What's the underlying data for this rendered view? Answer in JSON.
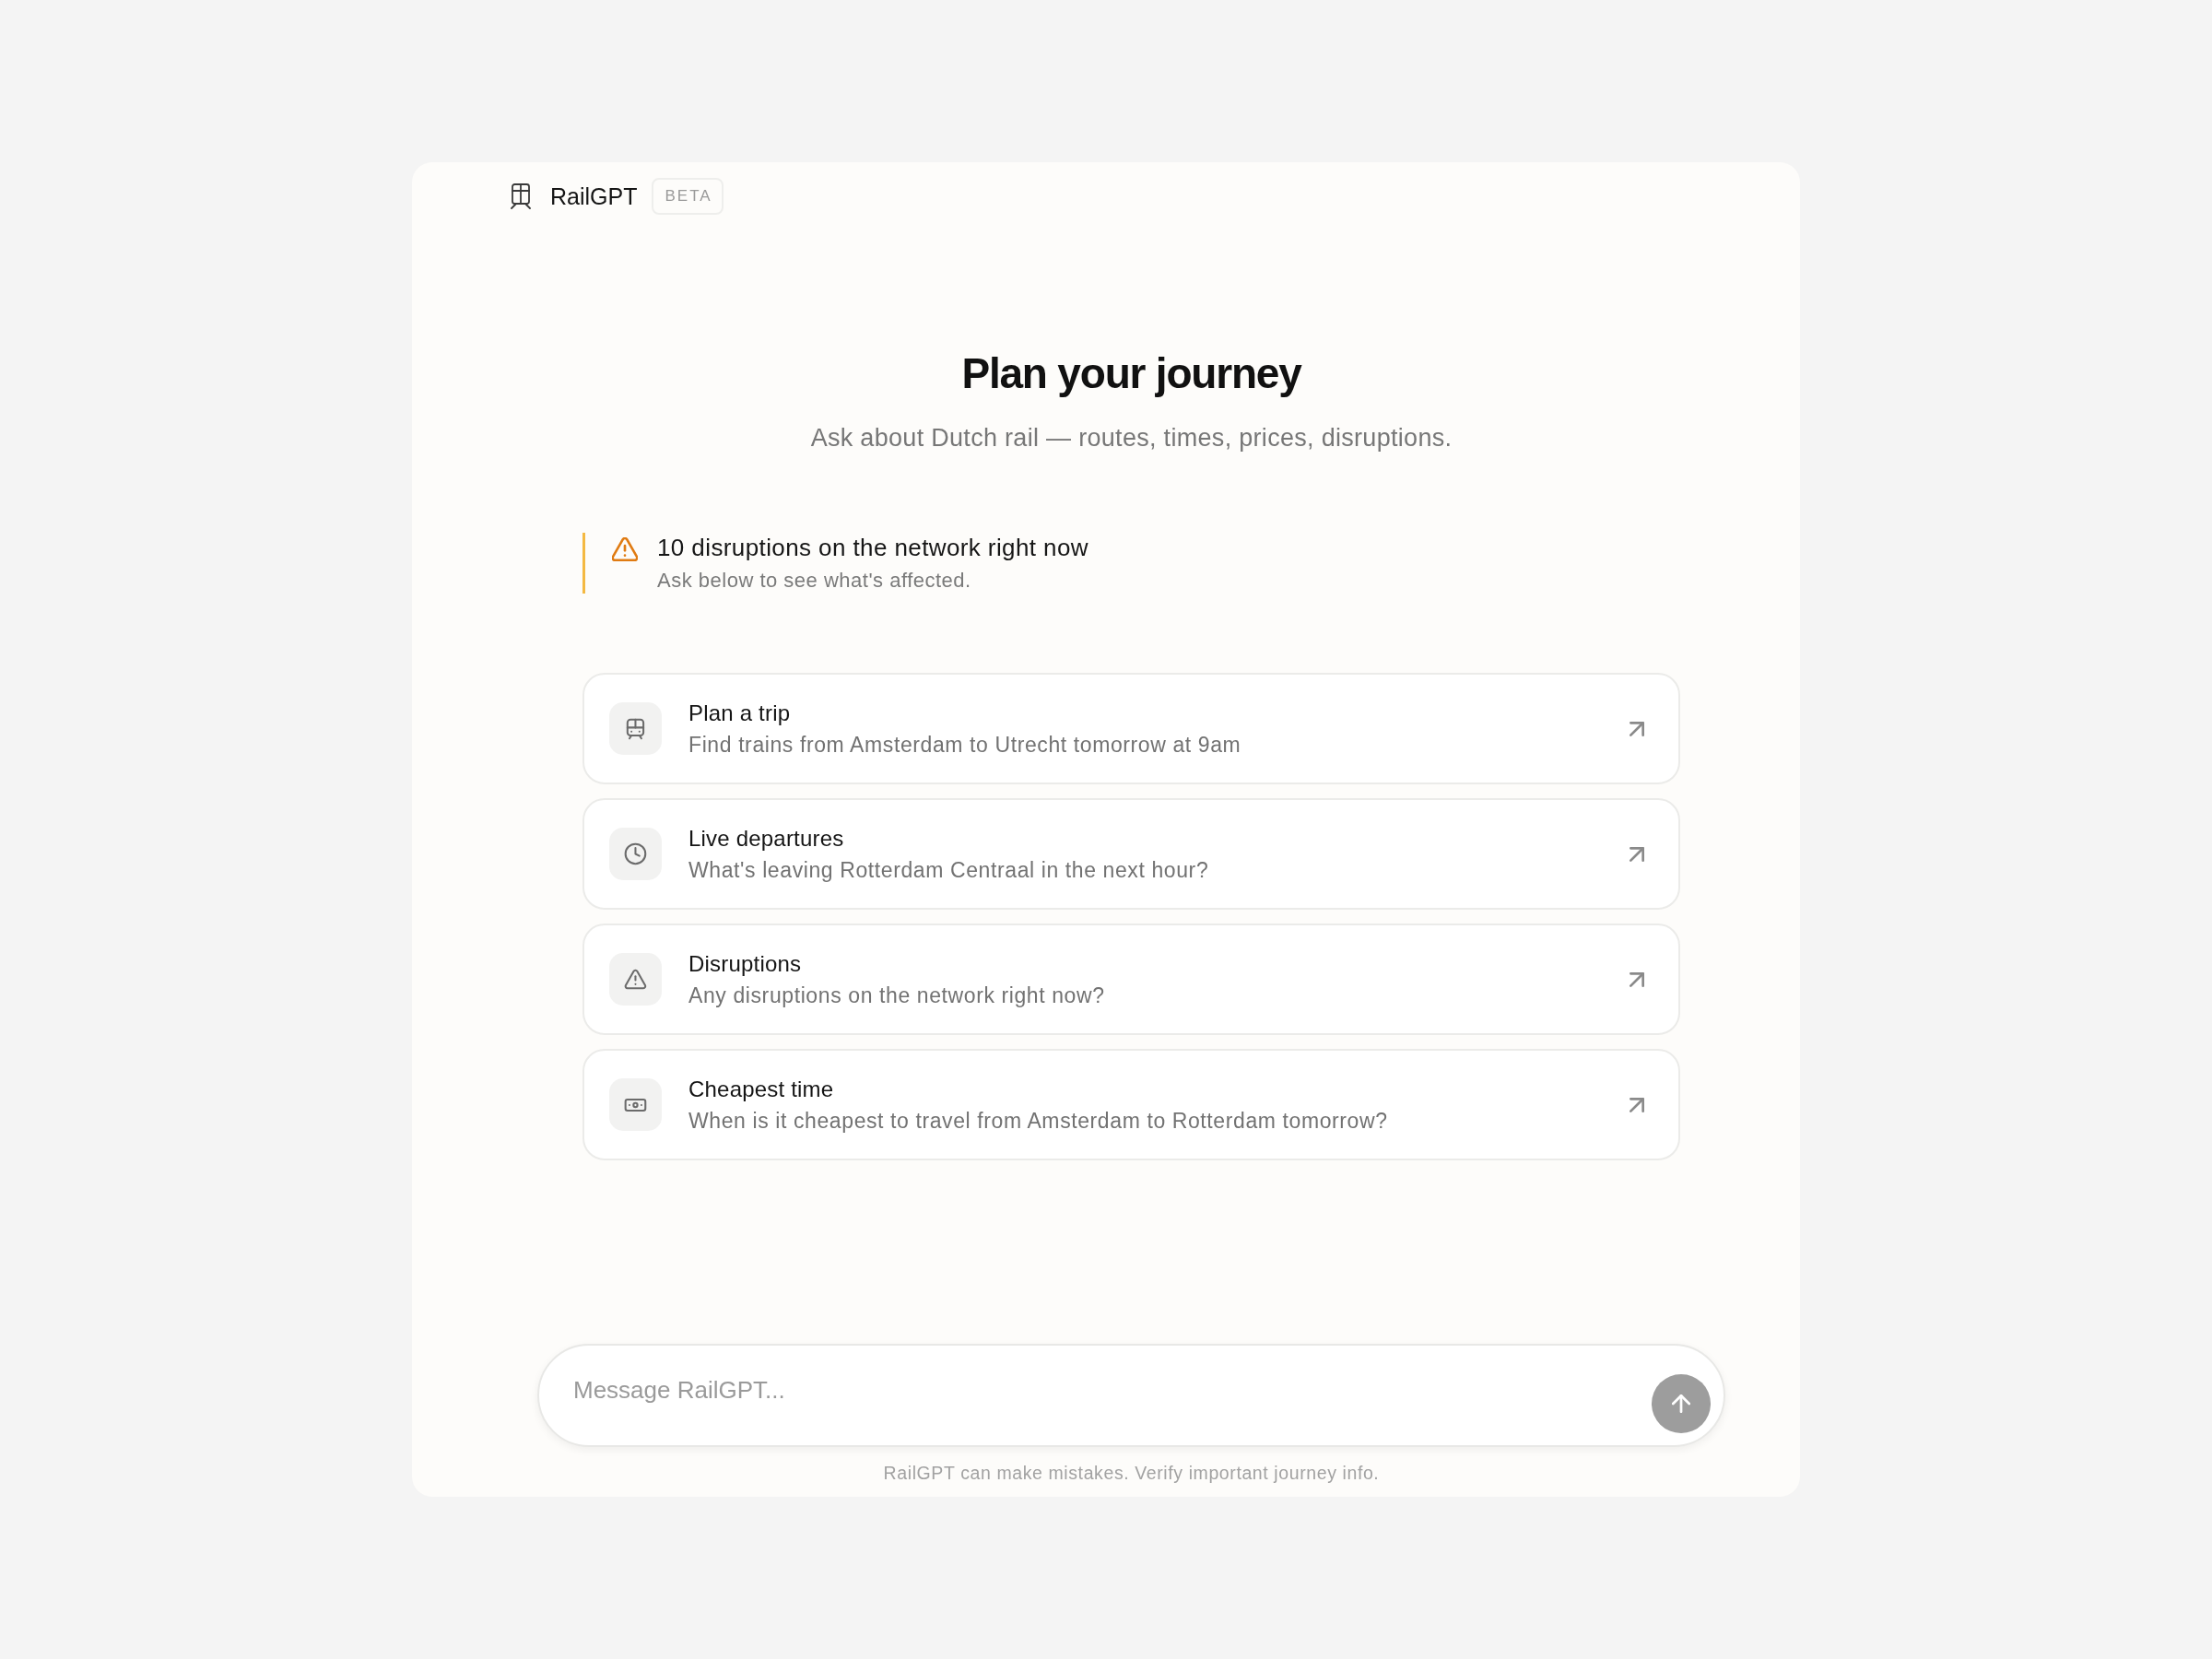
{
  "header": {
    "brand": "RailGPT",
    "badge": "BETA"
  },
  "hero": {
    "title": "Plan your journey",
    "subtitle": "Ask about Dutch rail — routes, times, prices, disruptions."
  },
  "alert": {
    "kind": "warning",
    "title": "10 disruptions on the network right now",
    "text": "Ask below to see what's affected."
  },
  "suggestions": [
    {
      "kind": "trip",
      "title": "Plan a trip",
      "prompt": "Find trains from Amsterdam to Utrecht tomorrow at 9am"
    },
    {
      "kind": "departures",
      "title": "Live departures",
      "prompt": "What's leaving Rotterdam Centraal in the next hour?"
    },
    {
      "kind": "disruptions",
      "title": "Disruptions",
      "prompt": "Any disruptions on the network right now?"
    },
    {
      "kind": "price",
      "title": "Cheapest time",
      "prompt": "When is it cheapest to travel from Amsterdam to Rotterdam tomorrow?"
    }
  ],
  "composer": {
    "placeholder": "Message RailGPT...",
    "send_disabled": true
  },
  "footer": {
    "note": "RailGPT can make mistakes. Verify important journey info."
  }
}
